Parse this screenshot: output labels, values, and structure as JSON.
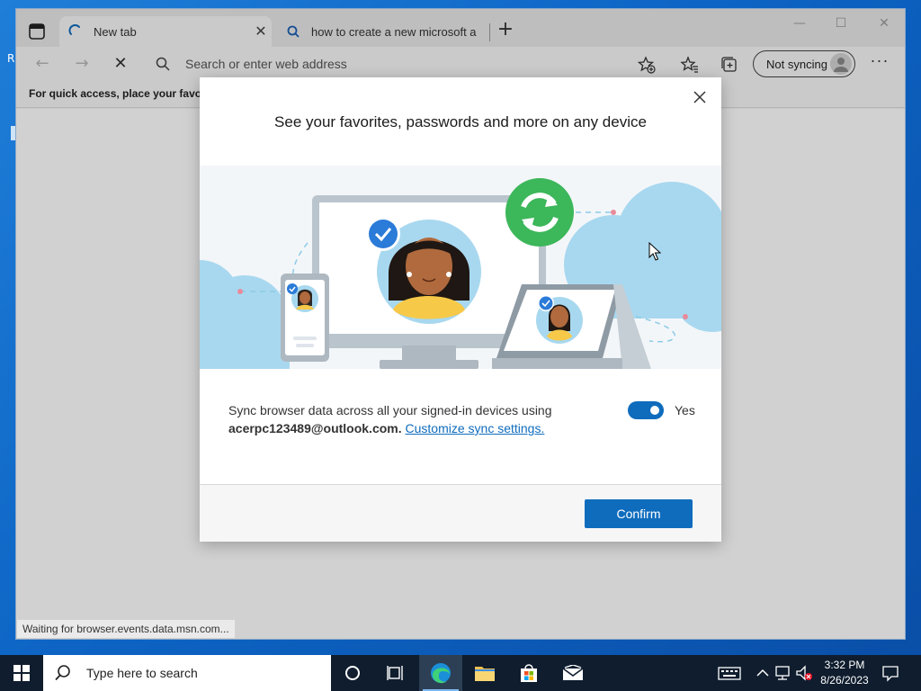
{
  "desktop": {
    "glyph": "R"
  },
  "browser": {
    "tabs": [
      {
        "title": "New tab",
        "loading": true
      },
      {
        "title": "how to create a new microsoft a"
      }
    ],
    "new_tab_symbol": "+",
    "window_controls": {
      "minimize": "—",
      "maximize": "☐",
      "close": "✕"
    },
    "address_placeholder": "Search or enter web address",
    "profile_button": "Not syncing",
    "more_symbol": "···",
    "favorites_bar_text": "For quick access, place your favorites here on the favorites bar.",
    "status_text": "Waiting for browser.events.data.msn.com..."
  },
  "dialog": {
    "title": "See your favorites, passwords and more on any device",
    "sync_text": "Sync browser data across all your signed-in devices using",
    "email": "acerpc123489@outlook.com.",
    "link_text": "Customize sync settings.",
    "toggle_on": true,
    "toggle_label": "Yes",
    "confirm_label": "Confirm"
  },
  "taskbar": {
    "search_placeholder": "Type here to search",
    "time": "3:32 PM",
    "date": "8/26/2023"
  },
  "colors": {
    "accent": "#0f6cbd",
    "sync_green": "#3cb75a",
    "skin": "#b06a3d",
    "shirt": "#f7c948",
    "sky_blue": "#a8d8ef"
  },
  "icons": [
    "tab-actions-icon",
    "loading-spinner-icon",
    "search-icon",
    "close-icon",
    "add-favorite-icon",
    "favorites-icon",
    "collections-icon",
    "avatar-icon",
    "windows-logo-icon",
    "task-view-icon",
    "cortana-icon",
    "edge-icon",
    "file-explorer-icon",
    "store-icon",
    "mail-icon",
    "keyboard-icon",
    "chevron-up-icon",
    "network-icon",
    "volume-muted-icon",
    "notification-icon"
  ]
}
